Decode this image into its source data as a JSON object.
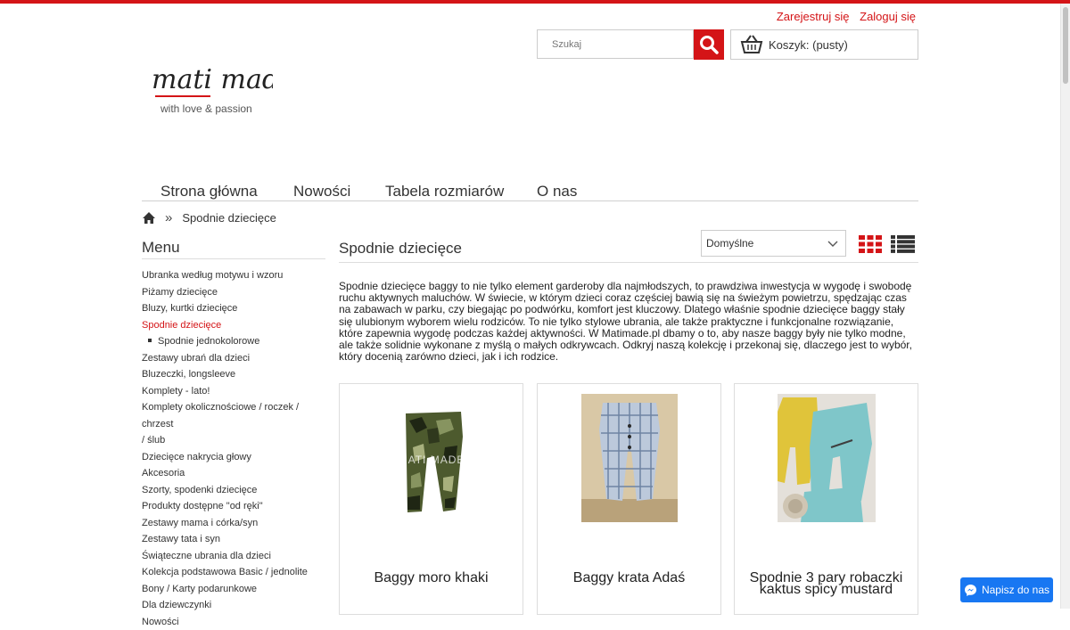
{
  "header": {
    "register_label": "Zarejestruj się",
    "login_label": "Zaloguj się",
    "search_placeholder": "Szukaj",
    "cart_label": "Koszyk: (pusty)"
  },
  "logo": {
    "name": "mati made",
    "tagline": "with love & passion"
  },
  "main_nav": [
    {
      "label": "Strona główna"
    },
    {
      "label": "Nowości"
    },
    {
      "label": "Tabela rozmiarów"
    },
    {
      "label": "O nas"
    }
  ],
  "breadcrumb": {
    "separator": "»",
    "current": "Spodnie dziecięce"
  },
  "sidebar": {
    "title": "Menu",
    "items": [
      {
        "label": "Ubranka według motywu i wzoru"
      },
      {
        "label": "Piżamy dziecięce"
      },
      {
        "label": "Bluzy, kurtki dziecięce"
      },
      {
        "label": "Spodnie dziecięce",
        "active": true
      },
      {
        "label": "Spodnie jednokolorowe",
        "sub": true
      },
      {
        "label": "Zestawy ubrań dla dzieci"
      },
      {
        "label": "Bluzeczki, longsleeve"
      },
      {
        "label": "Komplety - lato!"
      },
      {
        "label": "Komplety okolicznościowe / roczek / chrzest"
      },
      {
        "label": "/ ślub"
      },
      {
        "label": "Dziecięce nakrycia głowy"
      },
      {
        "label": "Akcesoria"
      },
      {
        "label": "Szorty, spodenki dziecięce"
      },
      {
        "label": "Produkty dostępne \"od ręki\""
      },
      {
        "label": "Zestawy mama i córka/syn"
      },
      {
        "label": "Zestawy tata i syn"
      },
      {
        "label": "Świąteczne ubrania dla dzieci"
      },
      {
        "label": "Kolekcja podstawowa Basic / jednolite"
      },
      {
        "label": "Bony / Karty podarunkowe"
      },
      {
        "label": "Dla dziewczynki"
      },
      {
        "label": "Nowości"
      }
    ]
  },
  "category": {
    "title": "Spodnie dziecięce",
    "sort_selected": "Domyślne",
    "description": "Spodnie dziecięce baggy to nie tylko element garderoby dla najmłodszych, to prawdziwa inwestycja w wygodę i swobodę ruchu aktywnych maluchów. W świecie, w którym dzieci coraz częściej bawią się na świeżym powietrzu, spędzając czas na zabawach w parku, czy biegając po podwórku, komfort jest kluczowy. Dlatego właśnie spodnie dziecięce baggy stały się ulubionym wyborem wielu rodziców. To nie tylko stylowe ubrania, ale także praktyczne i funkcjonalne rozwiązanie, które zapewnia wygodę podczas każdej aktywności. W Matimade.pl dbamy o to, aby nasze baggy były nie tylko modne, ale także solidnie wykonane z myślą o małych odkrywcach. Odkryj naszą kolekcję i przekonaj się, dlaczego jest to wybór, który docenią zarówno dzieci, jak i ich rodzice."
  },
  "products": [
    {
      "name": "Baggy moro khaki",
      "watermark": "MATI MADE"
    },
    {
      "name": "Baggy krata Adaś"
    },
    {
      "name_line1": "Spodnie 3 pary robaczki",
      "name_line2": "kaktus spicy mustard"
    }
  ],
  "chat": {
    "label": "Napisz do nas"
  },
  "colors": {
    "accent": "#d41417",
    "messenger": "#1877f2"
  }
}
